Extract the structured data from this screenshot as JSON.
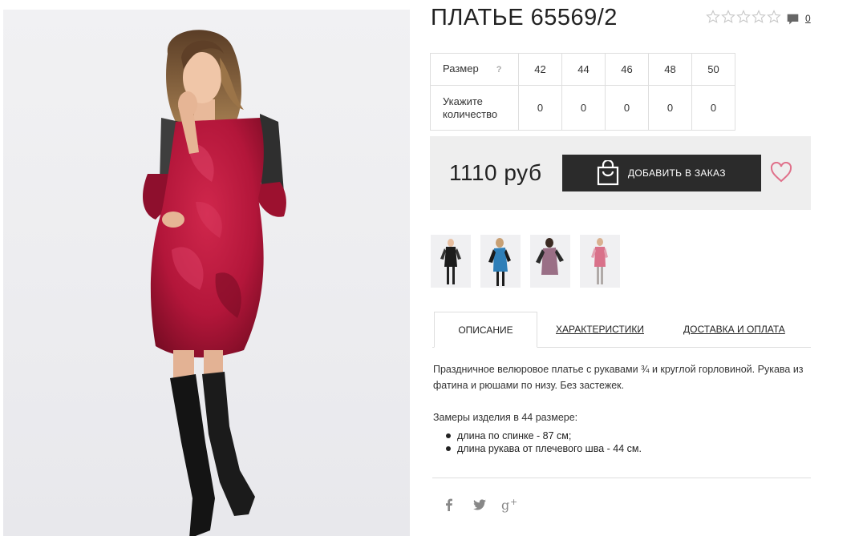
{
  "product": {
    "title": "ПЛАТЬЕ 65569/2",
    "rating_stars": 5,
    "rating_value": 0,
    "comments_count": "0"
  },
  "sizes_table": {
    "size_label": "Размер",
    "help_symbol": "?",
    "sizes": [
      "42",
      "44",
      "46",
      "48",
      "50"
    ],
    "qty_label": "Укажите количество",
    "quantities": [
      "0",
      "0",
      "0",
      "0",
      "0"
    ]
  },
  "purchase": {
    "price": "1110 руб",
    "add_button_label": "ДОБАВИТЬ В ЗАКАЗ"
  },
  "thumbnails": [
    {
      "name": "thumbnail-black-dress",
      "dress_color": "#1c1c1c"
    },
    {
      "name": "thumbnail-blue-dress",
      "dress_color": "#2f7fb8"
    },
    {
      "name": "thumbnail-mauve-dress",
      "dress_color": "#9a6f86"
    },
    {
      "name": "thumbnail-pink-dress",
      "dress_color": "#d9718a"
    }
  ],
  "tabs": [
    {
      "label": "ОПИСАНИЕ",
      "active": true
    },
    {
      "label": "ХАРАКТЕРИСТИКИ",
      "active": false
    },
    {
      "label": "ДОСТАВКА И ОПЛАТА",
      "active": false
    }
  ],
  "description": {
    "text": "Праздничное велюровое платье с рукавами ¾ и круглой горловиной. Рукава из фатина и рюшами по низу. Без застежек.",
    "measures_title": "Замеры изделия в 44 размере:",
    "measures": [
      "длина по спинке - 87 см;",
      "длина рукава от плечевого шва - 44 см."
    ]
  },
  "social": [
    {
      "icon": "facebook-icon",
      "glyph": "f"
    },
    {
      "icon": "twitter-icon",
      "glyph": "t"
    },
    {
      "icon": "google-plus-icon",
      "glyph": "g+"
    }
  ],
  "colors": {
    "dress": "#b3163a",
    "button_bg": "#2b2b2b",
    "price_block_bg": "#eeeeee",
    "heart": "#e0708a",
    "star": "#c8c8c8"
  }
}
